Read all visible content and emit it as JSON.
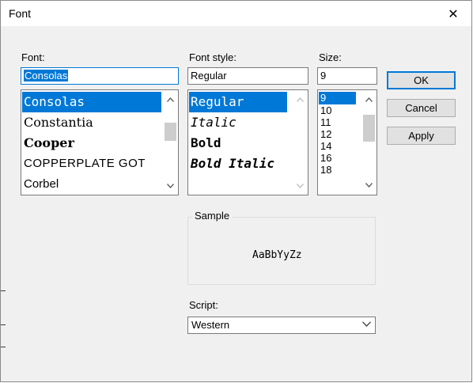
{
  "window": {
    "title": "Font",
    "close_glyph": "✕"
  },
  "font": {
    "label": "Font:",
    "value": "Consolas",
    "items": [
      "Consolas",
      "Constantia",
      "Cooper",
      "COPPERPLATE GOT",
      "Corbel"
    ]
  },
  "style": {
    "label": "Font style:",
    "value": "Regular",
    "items": [
      "Regular",
      "Italic",
      "Bold",
      "Bold Italic"
    ]
  },
  "size": {
    "label": "Size:",
    "value": "9",
    "items": [
      "9",
      "10",
      "11",
      "12",
      "14",
      "16",
      "18"
    ]
  },
  "buttons": {
    "ok": "OK",
    "cancel": "Cancel",
    "apply": "Apply"
  },
  "sample": {
    "label": "Sample",
    "text": "AaBbYyZz"
  },
  "script": {
    "label": "Script:",
    "value": "Western"
  },
  "colors": {
    "accent": "#0078d7",
    "dialog_bg": "#f0f0f0",
    "button_bg": "#e1e1e1"
  },
  "icons": {
    "close": "close-icon",
    "scroll_up": "chevron-up-icon",
    "scroll_down": "chevron-down-icon",
    "dropdown": "chevron-down-icon"
  }
}
